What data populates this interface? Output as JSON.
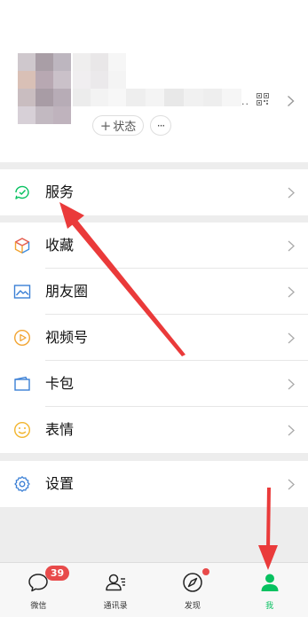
{
  "profile": {
    "ellipsis": "..",
    "status_label": "状态",
    "status_plus": "+",
    "more_label": "···",
    "avatar_pixels": [
      "#cfc8cd",
      "#a99ea6",
      "#bdb6bf",
      "#d9c0b6",
      "#b8a8b2",
      "#cac1c9",
      "#c9bdc0",
      "#a89ca5",
      "#b7acb6",
      "#d7d0d7",
      "#c2b9c1",
      "#bfb3bd"
    ],
    "name_pixels": [
      "#efeeee",
      "#e9e7e8",
      "#f6f6f6",
      "#f0eef0",
      "#ebe9eb",
      "#f4f4f4",
      "#ececec",
      "#f3f3f3",
      "#f7f7f7"
    ],
    "id_pixels": [
      "#eeeeee",
      "#f4f4f4",
      "#e8e8e8",
      "#f1f1f1",
      "#eeeeee",
      "#f6f6f6"
    ]
  },
  "menu": {
    "service": "服务",
    "favorites": "收藏",
    "moments": "朋友圈",
    "channels": "视频号",
    "cards": "卡包",
    "stickers": "表情",
    "settings": "设置"
  },
  "tabs": [
    {
      "label": "微信",
      "badge": "39"
    },
    {
      "label": "通讯录"
    },
    {
      "label": "发现"
    },
    {
      "label": "我"
    }
  ],
  "colors": {
    "accent": "#07c160",
    "badge": "#e84a4a",
    "annotation_arrow": "#ea3a3a"
  }
}
